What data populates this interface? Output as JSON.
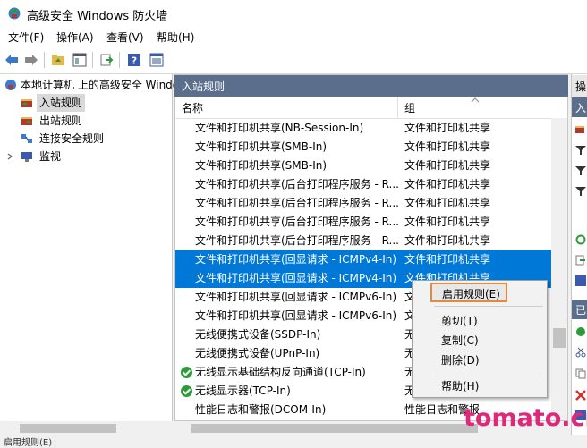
{
  "window": {
    "title": "高级安全 Windows 防火墙"
  },
  "menu": {
    "items": [
      "文件(F)",
      "操作(A)",
      "查看(V)",
      "帮助(H)"
    ]
  },
  "toolbar": {
    "icons": [
      "back-arrow-icon",
      "forward-arrow-icon",
      "folder-up-icon",
      "show-tree-icon",
      "export-icon",
      "help-icon",
      "properties-icon"
    ]
  },
  "tree": {
    "root": "本地计算机 上的高级安全 Windows",
    "items": [
      "入站规则",
      "出站规则",
      "连接安全规则",
      "监视"
    ]
  },
  "center": {
    "header": "入站规则",
    "col_name": "名称",
    "col_group": "组",
    "rows": [
      {
        "name": "文件和打印机共享(NB-Session-In)",
        "group": "文件和打印机共享",
        "enabled": false,
        "selected": false
      },
      {
        "name": "文件和打印机共享(SMB-In)",
        "group": "文件和打印机共享",
        "enabled": false,
        "selected": false
      },
      {
        "name": "文件和打印机共享(SMB-In)",
        "group": "文件和打印机共享",
        "enabled": false,
        "selected": false
      },
      {
        "name": "文件和打印机共享(后台打印程序服务 - R...",
        "group": "文件和打印机共享",
        "enabled": false,
        "selected": false
      },
      {
        "name": "文件和打印机共享(后台打印程序服务 - R...",
        "group": "文件和打印机共享",
        "enabled": false,
        "selected": false
      },
      {
        "name": "文件和打印机共享(后台打印程序服务 - R...",
        "group": "文件和打印机共享",
        "enabled": false,
        "selected": false
      },
      {
        "name": "文件和打印机共享(后台打印程序服务 - R...",
        "group": "文件和打印机共享",
        "enabled": false,
        "selected": false
      },
      {
        "name": "文件和打印机共享(回显请求 - ICMPv4-In)",
        "group": "文件和打印机共享",
        "enabled": false,
        "selected": true
      },
      {
        "name": "文件和打印机共享(回显请求 - ICMPv4-In)",
        "group": "文件和打印机共享",
        "enabled": false,
        "selected": true
      },
      {
        "name": "文件和打印机共享(回显请求 - ICMPv6-In)",
        "group": "文",
        "enabled": false,
        "selected": false
      },
      {
        "name": "文件和打印机共享(回显请求 - ICMPv6-In)",
        "group": "文",
        "enabled": false,
        "selected": false
      },
      {
        "name": "无线便携式设备(SSDP-In)",
        "group": "无",
        "enabled": false,
        "selected": false
      },
      {
        "name": "无线便携式设备(UPnP-In)",
        "group": "无",
        "enabled": false,
        "selected": false
      },
      {
        "name": "无线显示基础结构反向通道(TCP-In)",
        "group": "无",
        "enabled": true,
        "selected": false
      },
      {
        "name": "无线显示器(TCP-In)",
        "group": "无",
        "enabled": true,
        "selected": false
      },
      {
        "name": "性能日志和警报(DCOM-In)",
        "group": "性能日志和警报",
        "enabled": false,
        "selected": false
      }
    ]
  },
  "context_menu": {
    "enable_rule": "启用规则(E)",
    "cut": "剪切(T)",
    "copy": "复制(C)",
    "delete": "删除(D)",
    "help": "帮助(H)"
  },
  "actions": {
    "header": "操",
    "selected_header": "入",
    "section2_header": "已"
  },
  "status": {
    "text": "启用规则(E)"
  },
  "watermark": "tomato.cn",
  "colors": {
    "selection": "#0078d7",
    "pane_header": "#5b6e8c",
    "highlight_box": "#e68a3a",
    "watermark": "#e0287a"
  }
}
